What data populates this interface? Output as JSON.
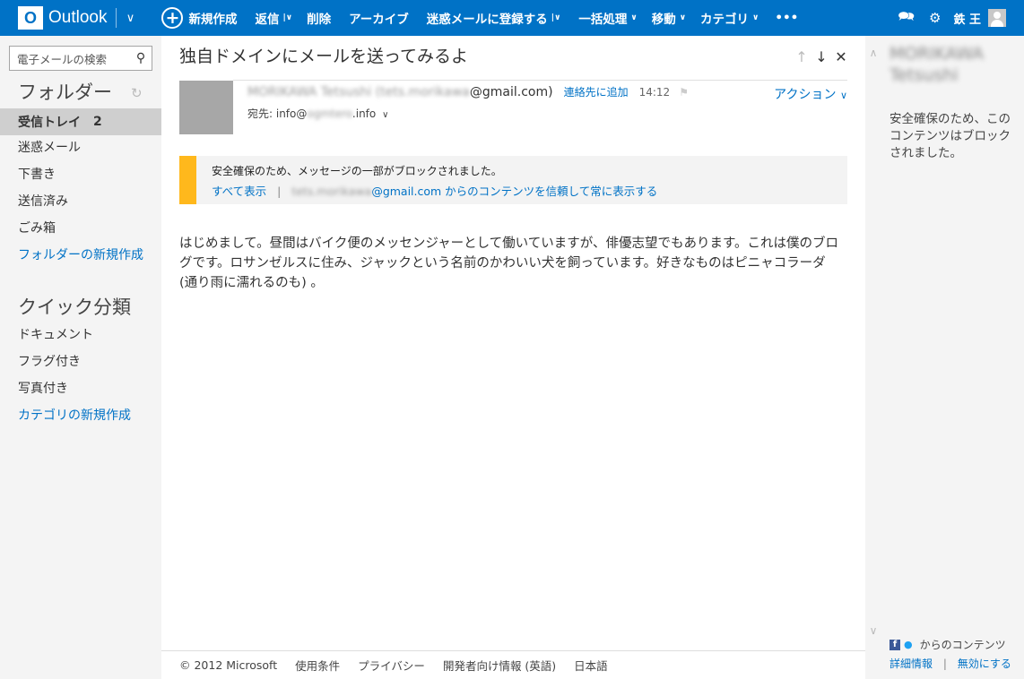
{
  "app": {
    "logo_letter": "O",
    "logo_text": "Outlook"
  },
  "toolbar": {
    "new": "新規作成",
    "reply": "返信",
    "delete": "削除",
    "archive": "アーカイブ",
    "junk": "迷惑メールに登録する",
    "sweep": "一括処理",
    "move": "移動",
    "category": "カテゴリ",
    "more": "•••"
  },
  "user": {
    "name": "鉄 王"
  },
  "sidebar": {
    "search_placeholder": "電子メールの検索",
    "folders_title": "フォルダー",
    "folders": [
      {
        "label": "受信トレイ",
        "count": "2"
      },
      {
        "label": "迷惑メール"
      },
      {
        "label": "下書き"
      },
      {
        "label": "送信済み"
      },
      {
        "label": "ごみ箱"
      }
    ],
    "new_folder": "フォルダーの新規作成",
    "quick_title": "クイック分類",
    "quick": [
      {
        "label": "ドキュメント"
      },
      {
        "label": "フラグ付き"
      },
      {
        "label": "写真付き"
      }
    ],
    "new_category": "カテゴリの新規作成"
  },
  "message": {
    "subject": "独自ドメインにメールを送ってみるよ",
    "from_name_blurred": "MORIKAWA Tetsushi (tets.morikawa",
    "from_domain": "@gmail.com)",
    "add_contact": "連絡先に追加",
    "time": "14:12",
    "to_label": "宛先: info@",
    "to_blurred": "ogmtero",
    "to_suffix": ".info",
    "action": "アクション",
    "warning_text": "安全確保のため、メッセージの一部がブロックされました。",
    "show_all": "すべて表示",
    "trust_blurred": "tets.morikawa",
    "trust_text": "@gmail.com からのコンテンツを信頼して常に表示する",
    "body": "はじめまして。昼間はバイク便のメッセンジャーとして働いていますが、俳優志望でもあります。これは僕のブログです。ロサンゼルスに住み、ジャックという名前のかわいい犬を飼っています。好きなものはピニャコラーダ (通り雨に濡れるのも) 。"
  },
  "footer": {
    "copyright": "© 2012 Microsoft",
    "terms": "使用条件",
    "privacy": "プライバシー",
    "developers": "開発者向け情報 (英語)",
    "language": "日本語"
  },
  "rightpane": {
    "name_blurred": "MORIKAWA Tetsushi",
    "blocked_msg": "安全確保のため、このコンテンツはブロックされました。",
    "social_text": "からのコンテンツ",
    "details": "詳細情報",
    "disable": "無効にする"
  }
}
